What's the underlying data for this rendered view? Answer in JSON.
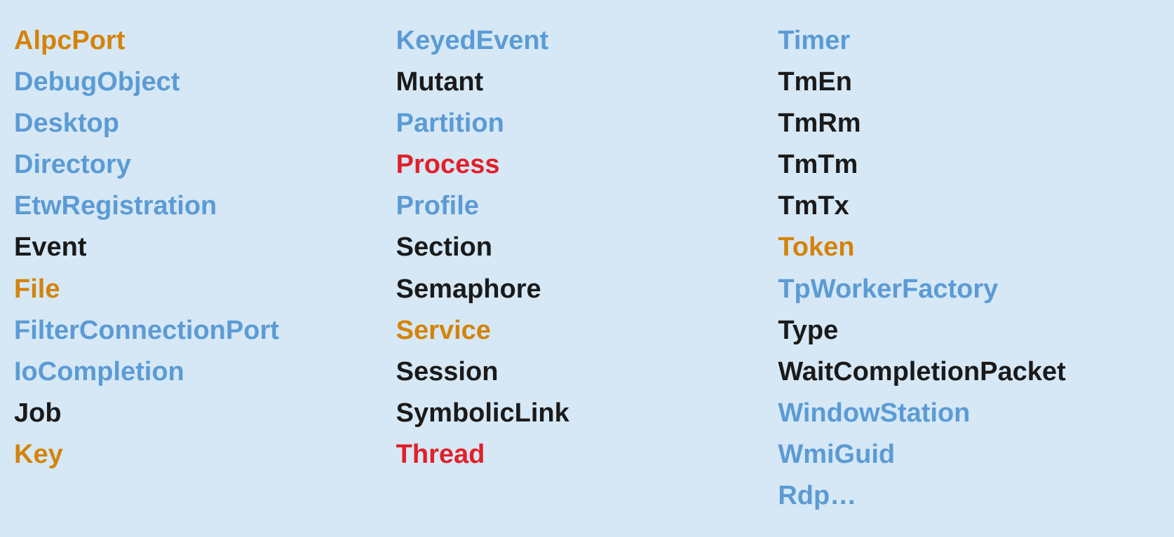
{
  "columns": [
    {
      "id": "col1",
      "items": [
        {
          "label": "AlpcPort",
          "color": "orange"
        },
        {
          "label": "DebugObject",
          "color": "blue"
        },
        {
          "label": "Desktop",
          "color": "blue"
        },
        {
          "label": "Directory",
          "color": "blue"
        },
        {
          "label": "EtwRegistration",
          "color": "blue"
        },
        {
          "label": "Event",
          "color": "black"
        },
        {
          "label": "File",
          "color": "orange"
        },
        {
          "label": "FilterConnectionPort",
          "color": "blue"
        },
        {
          "label": "IoCompletion",
          "color": "blue"
        },
        {
          "label": "Job",
          "color": "black"
        },
        {
          "label": "Key",
          "color": "orange"
        }
      ]
    },
    {
      "id": "col2",
      "items": [
        {
          "label": "KeyedEvent",
          "color": "blue"
        },
        {
          "label": "Mutant",
          "color": "black"
        },
        {
          "label": "Partition",
          "color": "blue"
        },
        {
          "label": "Process",
          "color": "red"
        },
        {
          "label": "Profile",
          "color": "blue"
        },
        {
          "label": "Section",
          "color": "black"
        },
        {
          "label": "Semaphore",
          "color": "black"
        },
        {
          "label": "Service",
          "color": "orange"
        },
        {
          "label": "Session",
          "color": "black"
        },
        {
          "label": "SymbolicLink",
          "color": "black"
        },
        {
          "label": "Thread",
          "color": "red"
        }
      ]
    },
    {
      "id": "col3",
      "items": [
        {
          "label": "Timer",
          "color": "blue"
        },
        {
          "label": "TmEn",
          "color": "black"
        },
        {
          "label": "TmRm",
          "color": "black"
        },
        {
          "label": "TmTm",
          "color": "black"
        },
        {
          "label": "TmTx",
          "color": "black"
        },
        {
          "label": "Token",
          "color": "orange"
        },
        {
          "label": "TpWorkerFactory",
          "color": "blue"
        },
        {
          "label": "Type",
          "color": "black"
        },
        {
          "label": "WaitCompletionPacket",
          "color": "black"
        },
        {
          "label": "WindowStation",
          "color": "blue"
        },
        {
          "label": "WmiGuid",
          "color": "blue"
        },
        {
          "label": "Rdp…",
          "color": "blue"
        }
      ]
    }
  ],
  "colorMap": {
    "orange": "#d4830a",
    "blue": "#5b9bd5",
    "black": "#1a1a1a",
    "red": "#e0202a"
  }
}
